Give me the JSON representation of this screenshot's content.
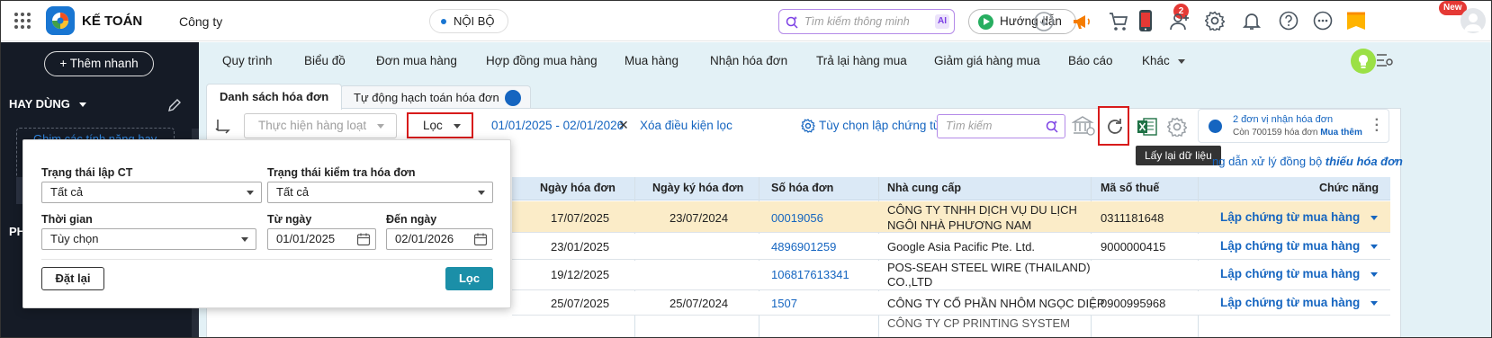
{
  "header": {
    "app_name": "KẾ TOÁN",
    "company": "Công ty",
    "scope": "NỘI BỘ",
    "smart_search_placeholder": "Tìm kiếm thông minh",
    "ai_label": "AI",
    "guide_label": "Hướng dẫn",
    "cart_badge": "2",
    "new_badge": "New"
  },
  "sidebar": {
    "quick_add": "Thêm nhanh",
    "section_title": "HAY DÙNG",
    "pin_hint": "Ghim các tính năng hay",
    "section2_partial": "PH"
  },
  "nav": {
    "items": [
      "Quy trình",
      "Biểu đồ",
      "Đơn mua hàng",
      "Hợp đồng mua hàng",
      "Mua hàng",
      "Nhận hóa đơn",
      "Trả lại hàng mua",
      "Giảm giá hàng mua",
      "Báo cáo",
      "Khác"
    ]
  },
  "tabs": {
    "active": "Danh sách hóa đơn",
    "other": "Tự động hạch toán hóa đơn"
  },
  "toolbar": {
    "bulk_action": "Thực hiện hàng loạt",
    "filter": "Lọc",
    "date_range": "01/01/2025 - 02/01/2026",
    "clear_filter": "Xóa điều kiện lọc",
    "options": "Tùy chọn lập chứng từ",
    "search_placeholder": "Tìm kiếm",
    "refresh_tooltip": "Lấy lại dữ liệu"
  },
  "promo": {
    "line1": "2 đơn vị nhận hóa đơn",
    "line2": "Còn 700159 hóa đơn",
    "more": "Mua thêm"
  },
  "sync_link": {
    "text": "ng dẫn xử lý đồng bộ ",
    "bold": "thiếu hóa đơn"
  },
  "table": {
    "columns": [
      "Ngày hóa đơn",
      "Ngày ký hóa đơn",
      "Số hóa đơn",
      "Nhà cung cấp",
      "Mã số thuế",
      "Chức năng"
    ],
    "rows": [
      {
        "date": "17/07/2025",
        "sign_date": "23/07/2024",
        "number": "00019056",
        "supplier_line1": "CÔNG TY TNHH DỊCH VỤ DU LỊCH",
        "supplier_line2": "NGÔI NHÀ PHƯƠNG NAM",
        "tax": "0311181648",
        "action": "Lập chứng từ mua hàng"
      },
      {
        "date": "23/01/2025",
        "sign_date": "",
        "number": "4896901259",
        "supplier_line1": "Google Asia Pacific Pte. Ltd.",
        "supplier_line2": "",
        "tax": "9000000415",
        "action": "Lập chứng từ mua hàng"
      },
      {
        "date": "19/12/2025",
        "sign_date": "",
        "number": "106817613341",
        "supplier_line1": "POS-SEAH STEEL WIRE (THAILAND)",
        "supplier_line2": "CO.,LTD",
        "tax": "",
        "action": "Lập chứng từ mua hàng"
      },
      {
        "date": "25/07/2025",
        "sign_date": "25/07/2024",
        "number": "1507",
        "supplier_line1": "CÔNG TY CỔ PHẦN NHÔM NGỌC DIỆP",
        "supplier_line2": "",
        "tax": "0900995968",
        "action": "Lập chứng từ mua hàng"
      }
    ],
    "partial_row": "CÔNG TY CP PRINTING SYSTEM"
  },
  "filter_popup": {
    "status_ct_label": "Trạng thái lập CT",
    "status_ct_value": "Tất cả",
    "status_check_label": "Trạng thái kiểm tra hóa đơn",
    "status_check_value": "Tất cả",
    "time_label": "Thời gian",
    "time_value": "Tùy chọn",
    "from_label": "Từ ngày",
    "from_value": "01/01/2025",
    "to_label": "Đến ngày",
    "to_value": "02/01/2026",
    "reset": "Đặt lại",
    "apply": "Lọc"
  },
  "colors": {
    "primary": "#1565c0",
    "highlight_row": "#fbecc8",
    "sidebar": "#151b26",
    "filter_border": "#d81b1b",
    "apply": "#1b8fa8"
  }
}
